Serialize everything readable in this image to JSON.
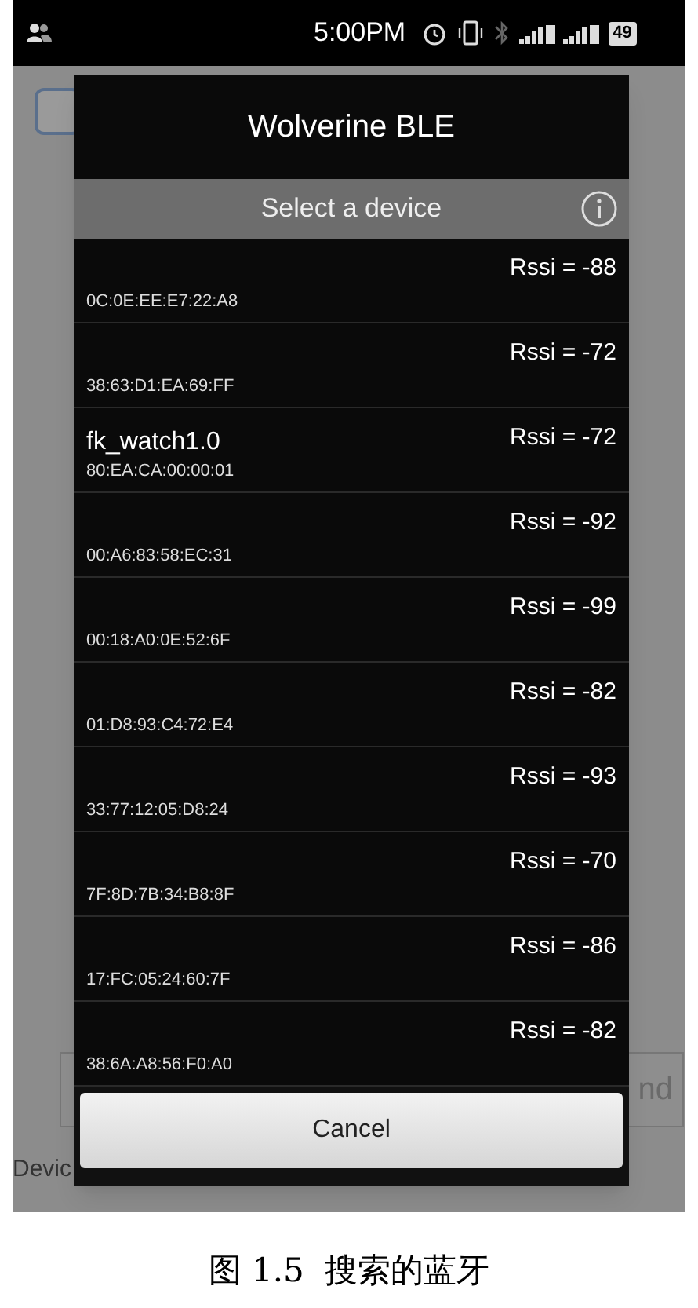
{
  "status_bar": {
    "time": "5:00PM",
    "battery": "49"
  },
  "background_app": {
    "button_fragment": "nd",
    "label_fragment": "Devic"
  },
  "dialog": {
    "title": "Wolverine BLE",
    "header": "Select a device",
    "devices": [
      {
        "address": "0C:0E:EE:E7:22:A8",
        "rssi": "Rssi = -88"
      },
      {
        "address": "38:63:D1:EA:69:FF",
        "rssi": "Rssi = -72"
      },
      {
        "name": "fk_watch1.0",
        "address": "80:EA:CA:00:00:01",
        "rssi": "Rssi = -72"
      },
      {
        "address": "00:A6:83:58:EC:31",
        "rssi": "Rssi = -92"
      },
      {
        "address": "00:18:A0:0E:52:6F",
        "rssi": "Rssi = -99"
      },
      {
        "address": "01:D8:93:C4:72:E4",
        "rssi": "Rssi = -82"
      },
      {
        "address": "33:77:12:05:D8:24",
        "rssi": "Rssi = -93"
      },
      {
        "address": "7F:8D:7B:34:B8:8F",
        "rssi": "Rssi = -70"
      },
      {
        "address": "17:FC:05:24:60:7F",
        "rssi": "Rssi = -86"
      },
      {
        "address": "38:6A:A8:56:F0:A0",
        "rssi": "Rssi = -82"
      }
    ],
    "cancel": "Cancel"
  },
  "caption": "图 1.5  搜索的蓝牙"
}
